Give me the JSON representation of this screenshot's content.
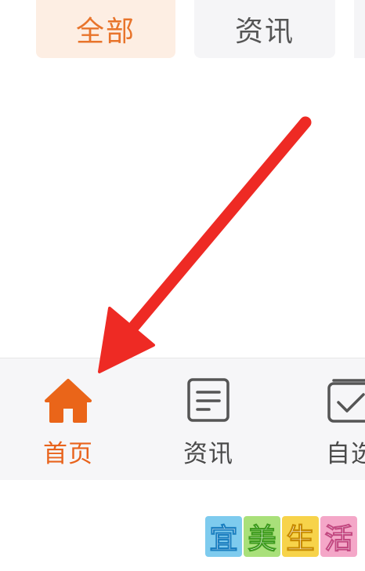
{
  "filter_tabs": [
    {
      "label": "全部",
      "active": true
    },
    {
      "label": "资讯",
      "active": false
    }
  ],
  "bottom_nav": {
    "items": [
      {
        "label": "首页",
        "icon": "home-icon",
        "active": true
      },
      {
        "label": "资讯",
        "icon": "news-document-icon",
        "active": false
      },
      {
        "label": "自选",
        "icon": "watchlist-checkbox-icon",
        "active": false
      }
    ]
  },
  "annotation": {
    "icon": "red-arrow-icon"
  },
  "watermark": {
    "chars": [
      "宜",
      "美",
      "生",
      "活"
    ]
  },
  "colors": {
    "accent": "#e8631c",
    "active_tab_bg": "#fdeee3",
    "arrow": "#ee2a24",
    "nav_bg": "#f6f6f8"
  }
}
